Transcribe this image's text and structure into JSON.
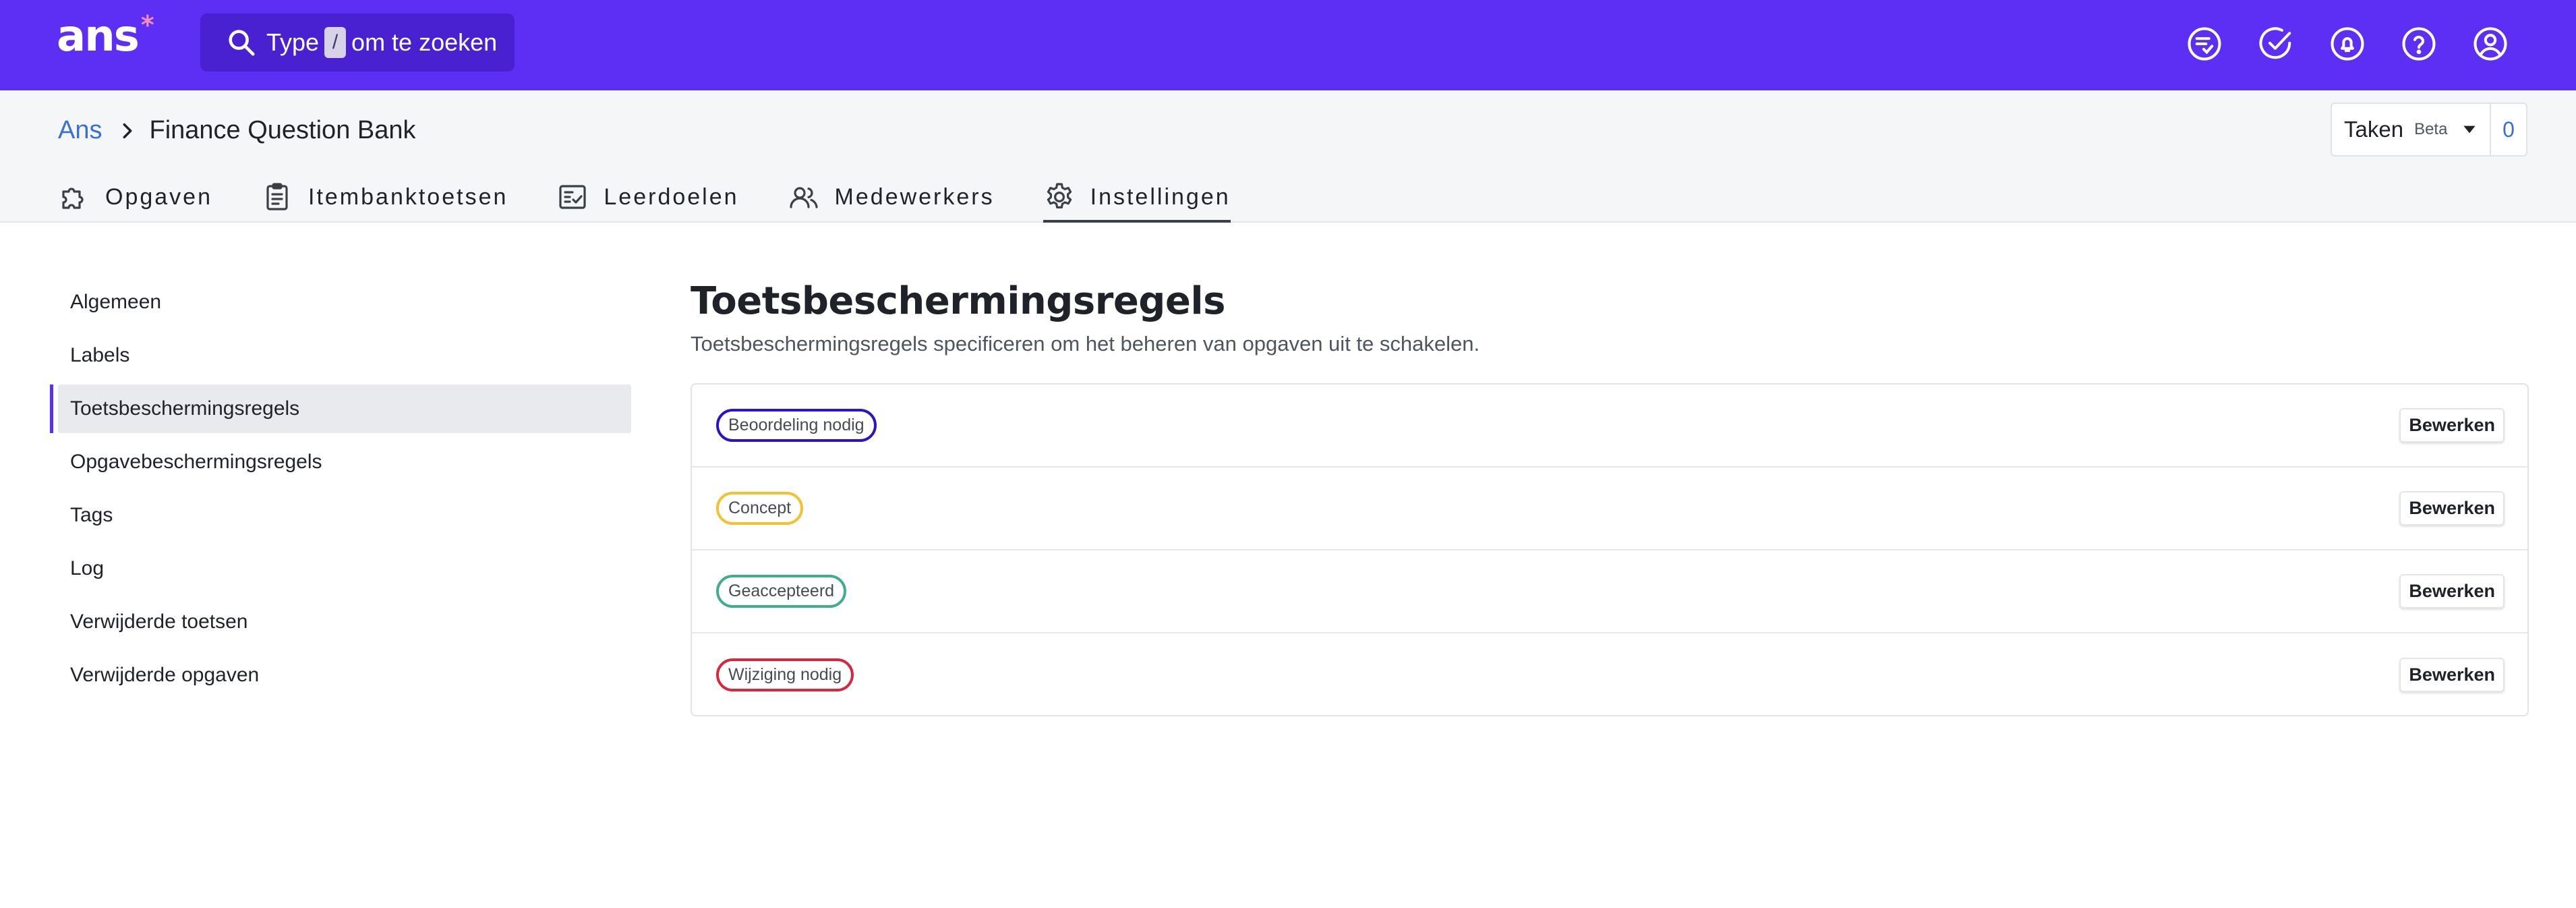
{
  "app": {
    "logo_text": "ans",
    "logo_mark": "*",
    "brand_color": "#5d2ff5"
  },
  "search": {
    "prefix": "Type",
    "shortcut": "/",
    "suffix": "om te zoeken"
  },
  "top_icons": [
    "review-list-icon",
    "check-circle-icon",
    "bell-icon",
    "help-icon",
    "user-account-icon"
  ],
  "breadcrumb": {
    "root": "Ans",
    "current": "Finance Question Bank"
  },
  "tasks": {
    "label": "Taken",
    "badge": "Beta",
    "count": "0"
  },
  "tabs": [
    {
      "label": "Opgaven",
      "icon": "puzzle-icon",
      "active": false
    },
    {
      "label": "Itembanktoetsen",
      "icon": "clipboard-icon",
      "active": false
    },
    {
      "label": "Leerdoelen",
      "icon": "checklist-icon",
      "active": false
    },
    {
      "label": "Medewerkers",
      "icon": "users-icon",
      "active": false
    },
    {
      "label": "Instellingen",
      "icon": "gear-icon",
      "active": true
    }
  ],
  "sidebar": {
    "items": [
      {
        "label": "Algemeen",
        "active": false
      },
      {
        "label": "Labels",
        "active": false
      },
      {
        "label": "Toetsbeschermingsregels",
        "active": true
      },
      {
        "label": "Opgavebeschermingsregels",
        "active": false
      },
      {
        "label": "Tags",
        "active": false
      },
      {
        "label": "Log",
        "active": false
      },
      {
        "label": "Verwijderde toetsen",
        "active": false
      },
      {
        "label": "Verwijderde opgaven",
        "active": false
      }
    ]
  },
  "main": {
    "title": "Toetsbeschermingsregels",
    "description": "Toetsbeschermingsregels specificeren om het beheren van opgaven uit te schakelen.",
    "edit_label": "Bewerken",
    "rules": [
      {
        "label": "Beoordeling nodig",
        "color": "#2b13c9"
      },
      {
        "label": "Concept",
        "color": "#f2c230"
      },
      {
        "label": "Geaccepteerd",
        "color": "#3fae8d"
      },
      {
        "label": "Wijziging nodig",
        "color": "#d7263d"
      }
    ]
  }
}
